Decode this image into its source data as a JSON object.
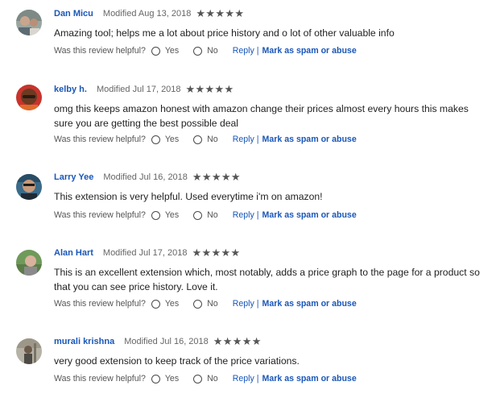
{
  "reviews": [
    {
      "author": "Dan Micu",
      "modified": "Modified Aug 13, 2018",
      "rating": 5,
      "text": "Amazing tool; helps me a lot about price history and o lot of other valuable info",
      "avatar_icon": "person-avatar-icon"
    },
    {
      "author": "kelby h.",
      "modified": "Modified Jul 17, 2018",
      "rating": 5,
      "text": "omg this keeps amazon honest with amazon change their prices almost every hours this makes sure you are getting the best possible deal",
      "avatar_icon": "person-avatar-icon"
    },
    {
      "author": "Larry Yee",
      "modified": "Modified Jul 16, 2018",
      "rating": 5,
      "text": "This extension is very helpful. Used everytime i'm on amazon!",
      "avatar_icon": "person-avatar-icon"
    },
    {
      "author": "Alan Hart",
      "modified": "Modified Jul 17, 2018",
      "rating": 5,
      "text": "This is an excellent extension which, most notably, adds a price graph to the page for a product so that you can see price history. Love it.",
      "avatar_icon": "person-avatar-icon"
    },
    {
      "author": "murali krishna",
      "modified": "Modified Jul 16, 2018",
      "rating": 5,
      "text": "very good extension to keep track of the price variations.",
      "avatar_icon": "person-avatar-icon"
    }
  ],
  "labels": {
    "helpful": "Was this review helpful?",
    "yes": "Yes",
    "no": "No",
    "reply": "Reply",
    "separator": "|",
    "spam": "Mark as spam or abuse",
    "star": "★"
  },
  "colors": {
    "link": "#1a57b8",
    "star": "#555555"
  }
}
